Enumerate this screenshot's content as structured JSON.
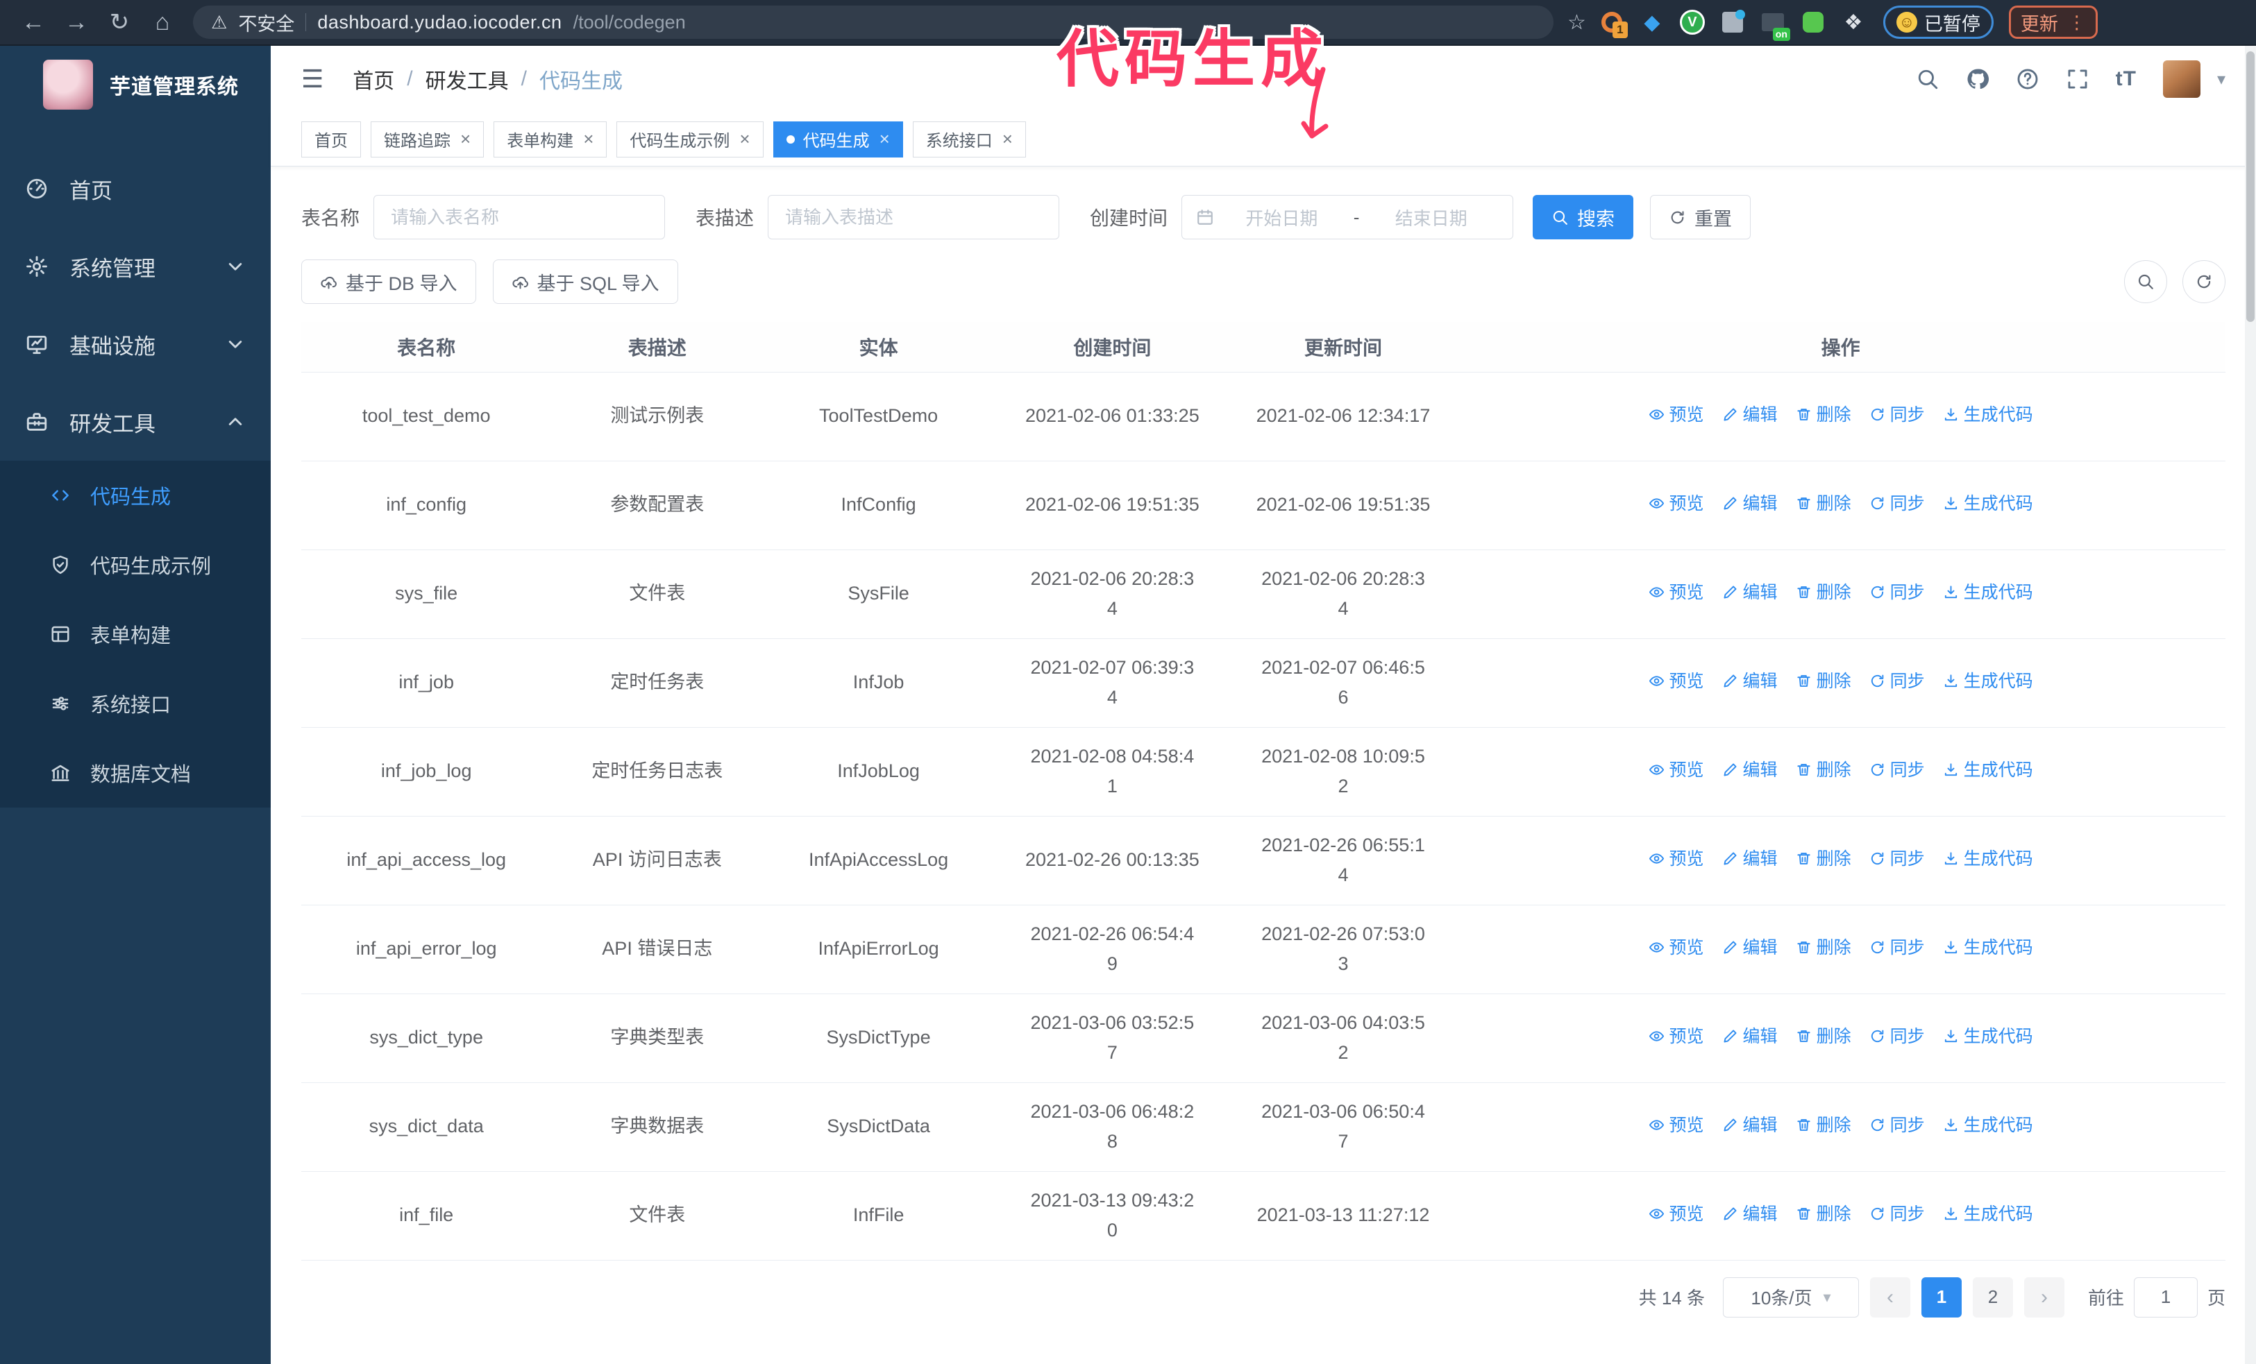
{
  "browser": {
    "security_label": "不安全",
    "url_host": "dashboard.yudao.iocoder.cn",
    "url_path": "/tool/codegen",
    "extension_badge": "1",
    "on_badge": "on",
    "paused_button": "已暂停",
    "update_button": "更新"
  },
  "annotation": {
    "text": "代码生成",
    "color": "#fb3a63"
  },
  "sidebar": {
    "title": "芋道管理系统",
    "items": [
      {
        "label": "首页",
        "icon": "gauge"
      },
      {
        "label": "系统管理",
        "icon": "gear",
        "chevron": "down"
      },
      {
        "label": "基础设施",
        "icon": "monitor",
        "chevron": "down"
      },
      {
        "label": "研发工具",
        "icon": "toolbox",
        "chevron": "up"
      }
    ],
    "submenu": [
      {
        "label": "代码生成",
        "icon": "code",
        "active": true
      },
      {
        "label": "代码生成示例",
        "icon": "shield"
      },
      {
        "label": "表单构建",
        "icon": "form"
      },
      {
        "label": "系统接口",
        "icon": "sliders"
      },
      {
        "label": "数据库文档",
        "icon": "columns"
      }
    ]
  },
  "header": {
    "breadcrumb": [
      "首页",
      "研发工具",
      "代码生成"
    ]
  },
  "tabs": [
    {
      "label": "首页",
      "closable": false,
      "active": false
    },
    {
      "label": "链路追踪",
      "closable": true,
      "active": false
    },
    {
      "label": "表单构建",
      "closable": true,
      "active": false
    },
    {
      "label": "代码生成示例",
      "closable": true,
      "active": false
    },
    {
      "label": "代码生成",
      "closable": true,
      "active": true
    },
    {
      "label": "系统接口",
      "closable": true,
      "active": false
    }
  ],
  "filters": {
    "name_label": "表名称",
    "name_placeholder": "请输入表名称",
    "desc_label": "表描述",
    "desc_placeholder": "请输入表描述",
    "date_label": "创建时间",
    "date_start_placeholder": "开始日期",
    "date_separator": "-",
    "date_end_placeholder": "结束日期",
    "search_button": "搜索",
    "reset_button": "重置"
  },
  "toolbar": {
    "import_db": "基于 DB 导入",
    "import_sql": "基于 SQL 导入"
  },
  "table": {
    "columns": [
      "表名称",
      "表描述",
      "实体",
      "创建时间",
      "更新时间",
      "操作"
    ],
    "actions": [
      "预览",
      "编辑",
      "删除",
      "同步",
      "生成代码"
    ],
    "rows": [
      {
        "name": "tool_test_demo",
        "desc": "测试示例表",
        "entity": "ToolTestDemo",
        "created": [
          "2021-02-06 01:33:25"
        ],
        "updated": [
          "2021-02-06 12:34:17"
        ]
      },
      {
        "name": "inf_config",
        "desc": "参数配置表",
        "entity": "InfConfig",
        "created": [
          "2021-02-06 19:51:35"
        ],
        "updated": [
          "2021-02-06 19:51:35"
        ]
      },
      {
        "name": "sys_file",
        "desc": "文件表",
        "entity": "SysFile",
        "created": [
          "2021-02-06 20:28:3",
          "4"
        ],
        "updated": [
          "2021-02-06 20:28:3",
          "4"
        ]
      },
      {
        "name": "inf_job",
        "desc": "定时任务表",
        "entity": "InfJob",
        "created": [
          "2021-02-07 06:39:3",
          "4"
        ],
        "updated": [
          "2021-02-07 06:46:5",
          "6"
        ]
      },
      {
        "name": "inf_job_log",
        "desc": "定时任务日志表",
        "entity": "InfJobLog",
        "created": [
          "2021-02-08 04:58:4",
          "1"
        ],
        "updated": [
          "2021-02-08 10:09:5",
          "2"
        ]
      },
      {
        "name": "inf_api_access_log",
        "desc": "API 访问日志表",
        "entity": "InfApiAccessLog",
        "created": [
          "2021-02-26 00:13:35"
        ],
        "updated": [
          "2021-02-26 06:55:1",
          "4"
        ]
      },
      {
        "name": "inf_api_error_log",
        "desc": "API 错误日志",
        "entity": "InfApiErrorLog",
        "created": [
          "2021-02-26 06:54:4",
          "9"
        ],
        "updated": [
          "2021-02-26 07:53:0",
          "3"
        ]
      },
      {
        "name": "sys_dict_type",
        "desc": "字典类型表",
        "entity": "SysDictType",
        "created": [
          "2021-03-06 03:52:5",
          "7"
        ],
        "updated": [
          "2021-03-06 04:03:5",
          "2"
        ]
      },
      {
        "name": "sys_dict_data",
        "desc": "字典数据表",
        "entity": "SysDictData",
        "created": [
          "2021-03-06 06:48:2",
          "8"
        ],
        "updated": [
          "2021-03-06 06:50:4",
          "7"
        ]
      },
      {
        "name": "inf_file",
        "desc": "文件表",
        "entity": "InfFile",
        "created": [
          "2021-03-13 09:43:2",
          "0"
        ],
        "updated": [
          "2021-03-13 11:27:12"
        ]
      }
    ]
  },
  "pagination": {
    "total": "共 14 条",
    "page_size": "10条/页",
    "pages": [
      "1",
      "2"
    ],
    "active_page": "1",
    "goto_label": "前往",
    "goto_value": "1",
    "goto_suffix": "页"
  },
  "colors": {
    "accent": "#2e8cf0",
    "sidebar_bg": "#1e3c57",
    "submenu_bg": "#16314a",
    "annotation": "#fb3a63"
  }
}
